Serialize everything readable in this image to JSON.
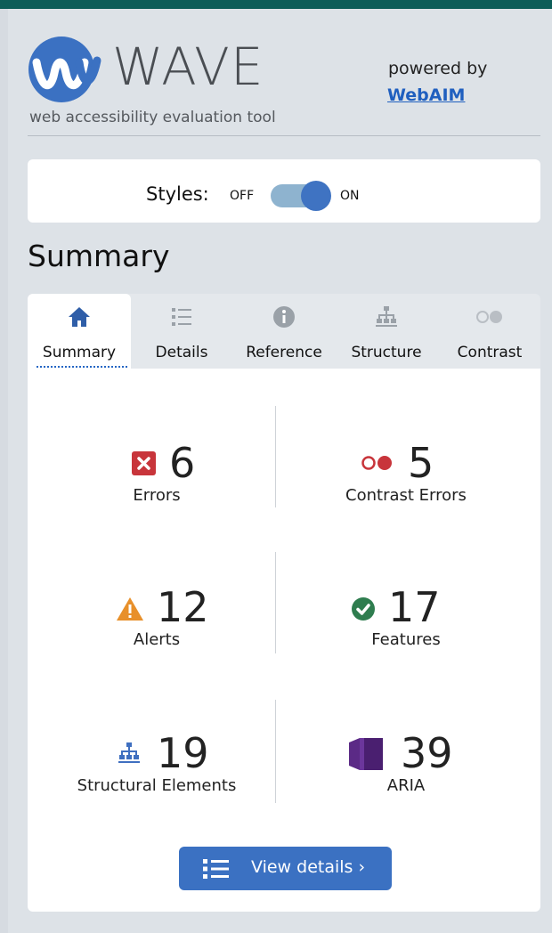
{
  "header": {
    "logo_text": "WAVE",
    "tagline": "web accessibility evaluation tool",
    "powered_by": "powered by",
    "webaim_link": "WebAIM"
  },
  "styles_toggle": {
    "label": "Styles:",
    "off": "OFF",
    "on": "ON",
    "state": "on"
  },
  "summary_heading": "Summary",
  "tabs": [
    {
      "label": "Summary",
      "icon": "home-icon",
      "active": true
    },
    {
      "label": "Details",
      "icon": "list-icon",
      "active": false
    },
    {
      "label": "Reference",
      "icon": "info-icon",
      "active": false
    },
    {
      "label": "Structure",
      "icon": "structure-icon",
      "active": false
    },
    {
      "label": "Contrast",
      "icon": "contrast-icon",
      "active": false
    }
  ],
  "stats": {
    "errors": {
      "count": "6",
      "label": "Errors",
      "icon": "error-icon",
      "color": "#c8353b"
    },
    "contrast_errors": {
      "count": "5",
      "label": "Contrast Errors",
      "icon": "contrast-error-icon",
      "color": "#c8353b"
    },
    "alerts": {
      "count": "12",
      "label": "Alerts",
      "icon": "alert-icon",
      "color": "#e8902b"
    },
    "features": {
      "count": "17",
      "label": "Features",
      "icon": "feature-icon",
      "color": "#2f7d4f"
    },
    "structural": {
      "count": "19",
      "label": "Structural Elements",
      "icon": "structure-icon",
      "color": "#3f6fc0"
    },
    "aria": {
      "count": "39",
      "label": "ARIA",
      "icon": "aria-icon",
      "color": "#5b2a86"
    }
  },
  "view_details_button": "View details ›",
  "colors": {
    "topbar": "#0d5d58",
    "accent": "#3b71c2",
    "panel_bg": "#dde2e7"
  }
}
